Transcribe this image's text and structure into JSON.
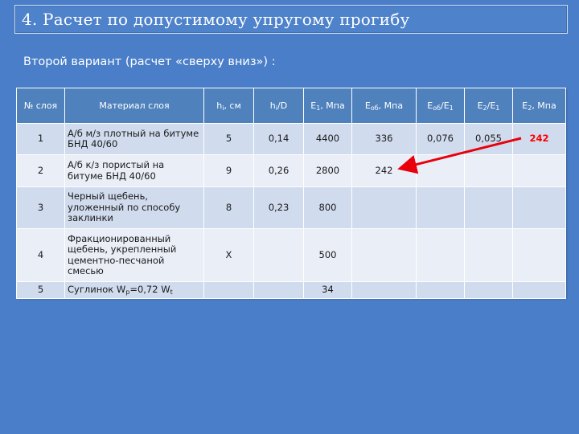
{
  "title": "4. Расчет по допустимому упругому прогибу",
  "subtitle": "Второй вариант (расчет «сверху вниз») :",
  "table": {
    "headers": {
      "layer_no": "№ слоя",
      "material": "Материал слоя",
      "hi_base": "h",
      "hi_sub": "i",
      "hi_tail": ", см",
      "hi_d_base": "h",
      "hi_d_sub": "i",
      "hi_d_tail": "/D",
      "e1_base": "E",
      "e1_sub": "1",
      "e1_tail": ", Мпа",
      "eob_base": "E",
      "eob_sub": "об",
      "eob_tail": ", Мпа",
      "eob_e1_base": "E",
      "eob_e1_sub": "об",
      "eob_e1_mid": "/E",
      "eob_e1_sub2": "1",
      "e2_e1_base": "E",
      "e2_e1_sub": "2",
      "e2_e1_mid": "/E",
      "e2_e1_sub2": "1",
      "e2_base": "E",
      "e2_sub": "2",
      "e2_tail": ", Мпа"
    },
    "rows": [
      {
        "no": "1",
        "material": "А/б м/з плотный на битуме БНД 40/60",
        "hi": "5",
        "hid": "0,14",
        "e1": "4400",
        "eob": "336",
        "eob_e1": "0,076",
        "e2_e1": "0,055",
        "e2": "242"
      },
      {
        "no": "2",
        "material": "А/б к/з пористый на битуме БНД 40/60",
        "hi": "9",
        "hid": "0,26",
        "e1": "2800",
        "eob": "242",
        "eob_e1": "",
        "e2_e1": "",
        "e2": ""
      },
      {
        "no": "3",
        "material": "Черный щебень, уложенный по способу заклинки",
        "hi": "8",
        "hid": "0,23",
        "e1": "800",
        "eob": "",
        "eob_e1": "",
        "e2_e1": "",
        "e2": ""
      },
      {
        "no": "4",
        "material": "Фракционированный щебень, укрепленный цементно-песчаной смесью",
        "hi": "Х",
        "hid": "",
        "e1": "500",
        "eob": "",
        "eob_e1": "",
        "e2_e1": "",
        "e2": ""
      },
      {
        "no": "5",
        "material_base": "Суглинок W",
        "material_sub": "p",
        "material_mid": "=0,72 W",
        "material_sub2": "t",
        "hi": "",
        "hid": "",
        "e1": "34",
        "eob": "",
        "eob_e1": "",
        "e2_e1": "",
        "e2": ""
      }
    ]
  },
  "colors": {
    "background": "#4a7ec8",
    "header": "#4f81bd",
    "highlight": "#ff0000"
  }
}
